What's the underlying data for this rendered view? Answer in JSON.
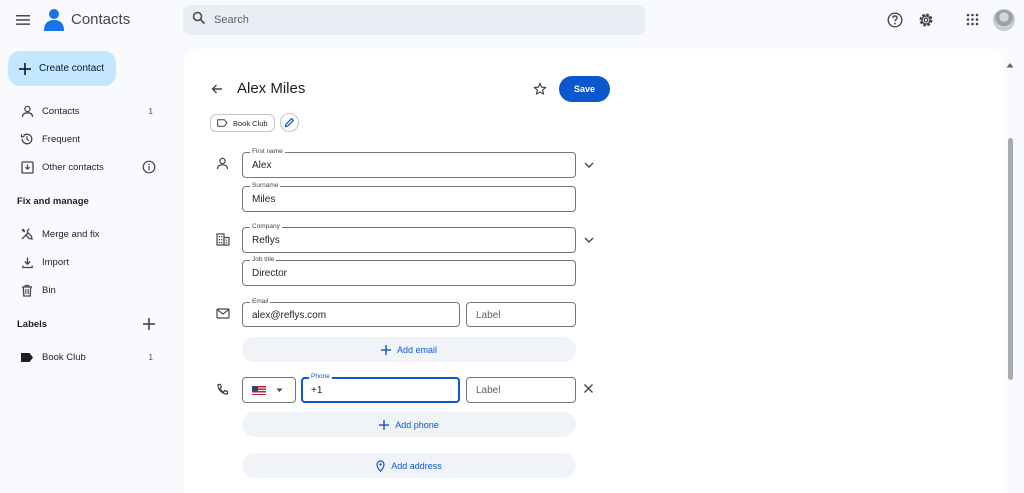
{
  "app": {
    "title": "Contacts"
  },
  "search": {
    "placeholder": "Search"
  },
  "sidebar": {
    "create_label": "Create contact",
    "items": [
      {
        "label": "Contacts",
        "count": "1",
        "icon": "person-icon"
      },
      {
        "label": "Frequent",
        "icon": "history-icon"
      },
      {
        "label": "Other contacts",
        "icon": "inbox-download-icon"
      }
    ],
    "fix_heading": "Fix and manage",
    "fix_items": [
      {
        "label": "Merge and fix",
        "icon": "tools-icon"
      },
      {
        "label": "Import",
        "icon": "download-icon"
      },
      {
        "label": "Bin",
        "icon": "trash-icon"
      }
    ],
    "labels_heading": "Labels",
    "labels": [
      {
        "label": "Book Club",
        "count": "1",
        "icon": "label-icon"
      }
    ]
  },
  "editor": {
    "name": "Alex Miles",
    "save_label": "Save",
    "chip_label": "Book Club",
    "fields": {
      "first_name": {
        "label": "First name",
        "value": "Alex"
      },
      "surname": {
        "label": "Surname",
        "value": "Miles"
      },
      "company": {
        "label": "Company",
        "value": "Reflys"
      },
      "job_title": {
        "label": "Job title",
        "value": "Director"
      },
      "email": {
        "label": "Email",
        "value": "alex@reflys.com"
      },
      "email_label": {
        "placeholder": "Label"
      },
      "phone": {
        "label": "Phone",
        "value": "+1"
      },
      "phone_label": {
        "placeholder": "Label"
      }
    },
    "add_email_label": "Add email",
    "add_phone_label": "Add phone",
    "add_address_label": "Add address"
  },
  "colors": {
    "accent": "#0b57d0",
    "create_bg": "#c2e7ff",
    "logo": "#1a73e8"
  }
}
